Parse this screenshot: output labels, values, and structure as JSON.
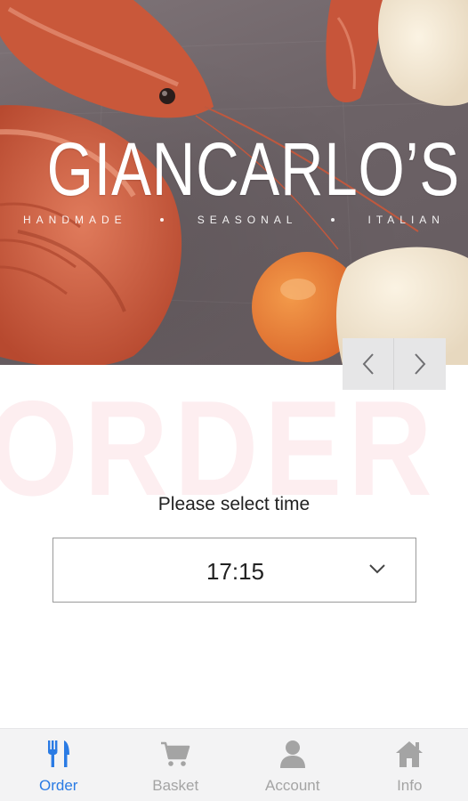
{
  "hero": {
    "brand": "GIANCARLO’S",
    "tagline": [
      "HANDMADE",
      "SEASONAL",
      "ITALIAN"
    ]
  },
  "carousel": {
    "prev_icon": "chevron-left-icon",
    "next_icon": "chevron-right-icon"
  },
  "main": {
    "watermark": "ORDER",
    "prompt": "Please select time",
    "time_select": {
      "value": "17:15",
      "icon": "chevron-down-icon"
    }
  },
  "nav": {
    "items": [
      {
        "label": "Order",
        "icon": "fork-knife-icon",
        "active": true
      },
      {
        "label": "Basket",
        "icon": "cart-icon",
        "active": false
      },
      {
        "label": "Account",
        "icon": "person-icon",
        "active": false
      },
      {
        "label": "Info",
        "icon": "house-icon",
        "active": false
      }
    ]
  },
  "colors": {
    "accent": "#2a7be4",
    "inactive": "#a4a4a4",
    "watermark": "#fdeef0"
  }
}
